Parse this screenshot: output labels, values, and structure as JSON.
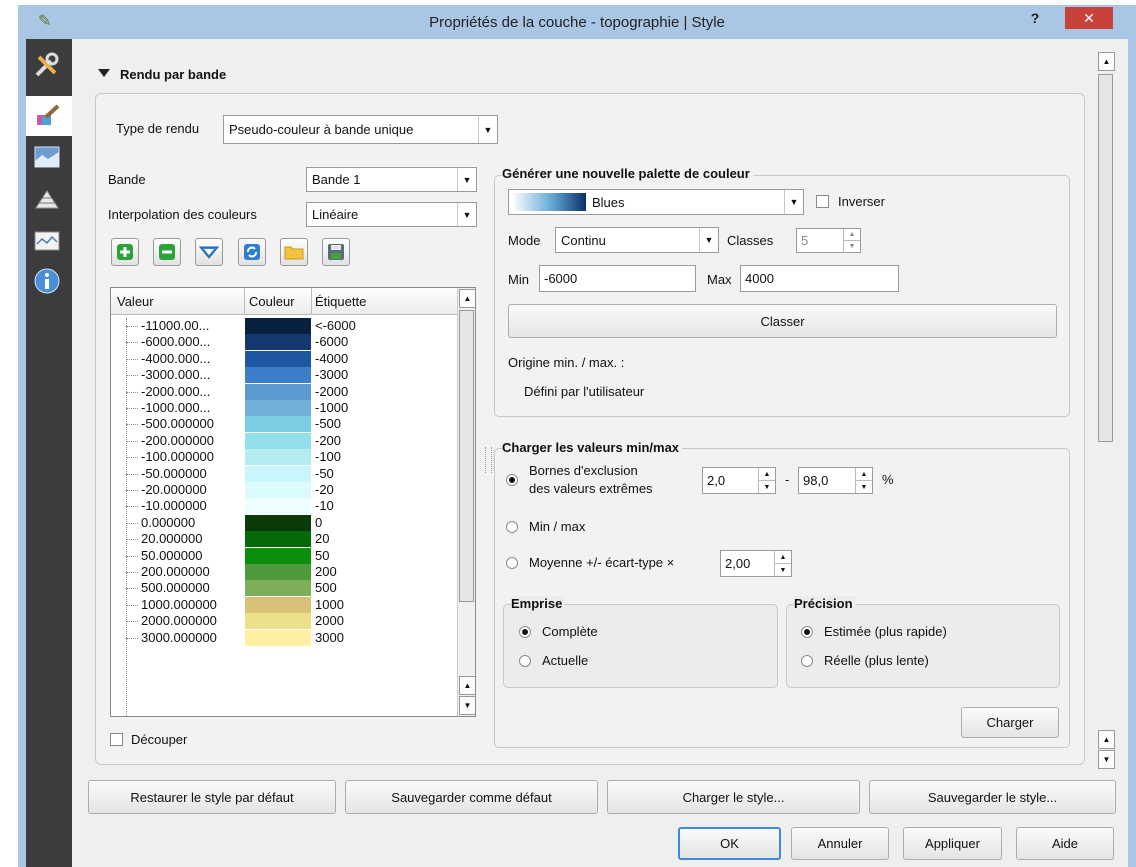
{
  "window": {
    "title": "Propriétés de la couche - topographie | Style",
    "help_glyph": "?",
    "close_glyph": "✕"
  },
  "section": {
    "title": "Rendu par bande"
  },
  "render_type": {
    "label": "Type de rendu",
    "value": "Pseudo-couleur à bande unique"
  },
  "band": {
    "label": "Bande",
    "value": "Bande 1"
  },
  "interpolation": {
    "label": "Interpolation des couleurs",
    "value": "Linéaire"
  },
  "toolbar_icons": [
    "add-icon",
    "remove-icon",
    "load-classes-icon",
    "refresh-icon",
    "folder-icon",
    "save-icon"
  ],
  "table": {
    "headers": [
      "Valeur",
      "Couleur",
      "Étiquette"
    ],
    "rows": [
      {
        "value": "-11000.00...",
        "color": "#08213f",
        "label": "<-6000"
      },
      {
        "value": "-6000.000...",
        "color": "#133872",
        "label": "-6000"
      },
      {
        "value": "-4000.000...",
        "color": "#1f57a0",
        "label": "-4000"
      },
      {
        "value": "-3000.000...",
        "color": "#3c7fc8",
        "label": "-3000"
      },
      {
        "value": "-2000.000...",
        "color": "#5a9ad0",
        "label": "-2000"
      },
      {
        "value": "-1000.000...",
        "color": "#73b0d8",
        "label": "-1000"
      },
      {
        "value": "-500.000000",
        "color": "#7ccfe2",
        "label": "-500"
      },
      {
        "value": "-200.000000",
        "color": "#93e0ec",
        "label": "-200"
      },
      {
        "value": "-100.000000",
        "color": "#b4ecf2",
        "label": "-100"
      },
      {
        "value": "-50.000000",
        "color": "#c9f6fa",
        "label": "-50"
      },
      {
        "value": "-20.000000",
        "color": "#dafafc",
        "label": "-20"
      },
      {
        "value": "-10.000000",
        "color": "#eefdfe",
        "label": "-10"
      },
      {
        "value": "0.000000",
        "color": "#0b3a08",
        "label": "0"
      },
      {
        "value": "20.000000",
        "color": "#066a08",
        "label": "20"
      },
      {
        "value": "50.000000",
        "color": "#0b8f0c",
        "label": "50"
      },
      {
        "value": "200.000000",
        "color": "#4f9a3c",
        "label": "200"
      },
      {
        "value": "500.000000",
        "color": "#7dae5a",
        "label": "500"
      },
      {
        "value": "1000.000000",
        "color": "#d8c27a",
        "label": "1000"
      },
      {
        "value": "2000.000000",
        "color": "#ede08a",
        "label": "2000"
      },
      {
        "value": "3000.000000",
        "color": "#fff0a6",
        "label": "3000"
      }
    ]
  },
  "clip": {
    "label": "Découper",
    "checked": false
  },
  "generate": {
    "title": "Générer une nouvelle palette de couleur",
    "ramp": "Blues",
    "invert_label": "Inverser",
    "mode_label": "Mode",
    "mode_value": "Continu",
    "classes_label": "Classes",
    "classes_value": "5",
    "min_label": "Min",
    "min_value": "-6000",
    "max_label": "Max",
    "max_value": "4000",
    "classify_button": "Classer",
    "origin_label": "Origine min. / max. :",
    "origin_value": "Défini par l'utilisateur"
  },
  "minmax": {
    "title": "Charger les valeurs min/max",
    "cut_label_1": "Bornes d'exclusion",
    "cut_label_2": "des valeurs extrêmes",
    "cut_low": "2,0",
    "dash": "-",
    "cut_high": "98,0",
    "percent": "%",
    "minmax_label": "Min / max",
    "mean_label": "Moyenne +/- écart-type ×",
    "mean_value": "2,00",
    "extent_title": "Emprise",
    "extent_full": "Complète",
    "extent_current": "Actuelle",
    "accuracy_title": "Précision",
    "accuracy_estimate": "Estimée (plus rapide)",
    "accuracy_actual": "Réelle (plus lente)",
    "load_button": "Charger"
  },
  "style_buttons": {
    "restore": "Restaurer le style par défaut",
    "save_default": "Sauvegarder comme défaut",
    "load": "Charger le style...",
    "save": "Sauvegarder le style..."
  },
  "dialog_buttons": {
    "ok": "OK",
    "cancel": "Annuler",
    "apply": "Appliquer",
    "help": "Aide"
  },
  "colors": {
    "accent": "#0063b1",
    "close": "#c9423a",
    "sidebar": "#3c3c3c"
  }
}
